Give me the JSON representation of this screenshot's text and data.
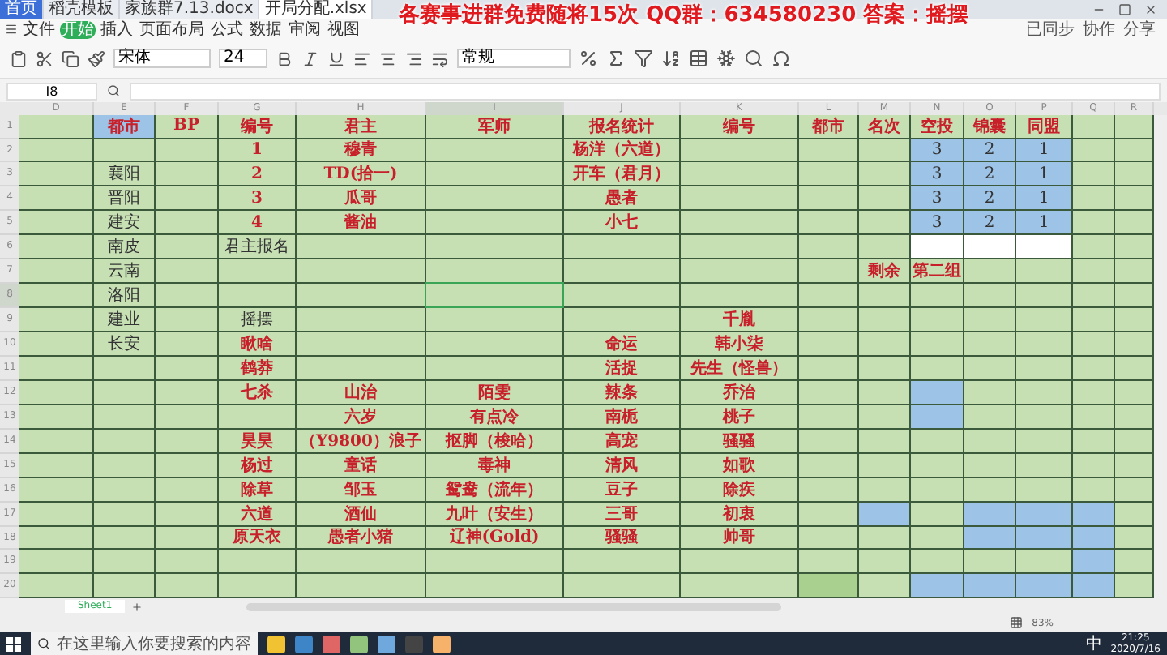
{
  "tabs": [
    {
      "label": "首页",
      "selected": false
    },
    {
      "label": "稻壳模板",
      "selected": false
    },
    {
      "label": "家族群7.13.docx",
      "selected": false
    },
    {
      "label": "开局分配.xlsx",
      "selected": true
    }
  ],
  "banner": "各赛事进群免费随将15次 QQ群：634580230 答案：摇摆",
  "menu": [
    {
      "label": "文件",
      "selected": false
    },
    {
      "label": "开始",
      "selected": true
    },
    {
      "label": "插入",
      "selected": false
    },
    {
      "label": "页面布局",
      "selected": false
    },
    {
      "label": "公式",
      "selected": false
    },
    {
      "label": "数据",
      "selected": false
    },
    {
      "label": "审阅",
      "selected": false
    },
    {
      "label": "视图",
      "selected": false
    }
  ],
  "sync": [
    "已同步",
    "协作",
    "分享"
  ],
  "toolbar": {
    "font": "宋体",
    "size": "24",
    "format": "常规"
  },
  "formula_bar": {
    "cell": "I8"
  },
  "columns": [
    {
      "letter": "D",
      "selected": false
    },
    {
      "letter": "E",
      "selected": false
    },
    {
      "letter": "F",
      "selected": false
    },
    {
      "letter": "G",
      "selected": false
    },
    {
      "letter": "H",
      "selected": false
    },
    {
      "letter": "I",
      "selected": true
    },
    {
      "letter": "J",
      "selected": false
    },
    {
      "letter": "K",
      "selected": false
    },
    {
      "letter": "L",
      "selected": false
    },
    {
      "letter": "M",
      "selected": false
    },
    {
      "letter": "N",
      "selected": false
    },
    {
      "letter": "O",
      "selected": false
    },
    {
      "letter": "P",
      "selected": false
    },
    {
      "letter": "Q",
      "selected": false
    },
    {
      "letter": "R",
      "selected": false
    }
  ],
  "rows": [
    {
      "number": "1",
      "selected": false,
      "cells": [
        {},
        {
          "text": "都市",
          "kind": "emphasis",
          "color": "#9dc3e6"
        },
        {
          "text": "BP",
          "kind": "emphasis"
        },
        {
          "text": "编号",
          "kind": "emphasis"
        },
        {
          "text": "君主",
          "kind": "emphasis"
        },
        {
          "text": "军师",
          "kind": "emphasis"
        },
        {
          "text": "报名统计",
          "kind": "emphasis"
        },
        {
          "text": "编号",
          "kind": "emphasis"
        },
        {
          "text": "都市",
          "kind": "emphasis"
        },
        {
          "text": "名次",
          "kind": "emphasis"
        },
        {
          "text": "空投",
          "kind": "emphasis"
        },
        {
          "text": "锦囊",
          "kind": "emphasis"
        },
        {
          "text": "同盟",
          "kind": "emphasis"
        },
        {},
        {}
      ]
    },
    {
      "number": "2",
      "selected": false,
      "cells": [
        {},
        {},
        {},
        {
          "text": "1",
          "kind": "emphasis"
        },
        {
          "text": "穆青",
          "kind": "emphasis"
        },
        {},
        {
          "text": "杨洋（六道）",
          "kind": "emphasis"
        },
        {},
        {},
        {},
        {
          "text": "3",
          "kind": "plain",
          "color": "#9dc3e6"
        },
        {
          "text": "2",
          "kind": "plain",
          "color": "#9dc3e6"
        },
        {
          "text": "1",
          "kind": "plain",
          "color": "#9dc3e6"
        },
        {},
        {}
      ]
    },
    {
      "number": "3",
      "selected": false,
      "cells": [
        {},
        {
          "text": "襄阳",
          "kind": "plain"
        },
        {},
        {
          "text": "2",
          "kind": "emphasis"
        },
        {
          "text": "TD(拾一)",
          "kind": "emphasis"
        },
        {},
        {
          "text": "开车（君月）",
          "kind": "emphasis"
        },
        {},
        {},
        {},
        {
          "text": "3",
          "kind": "plain",
          "color": "#9dc3e6"
        },
        {
          "text": "2",
          "kind": "plain",
          "color": "#9dc3e6"
        },
        {
          "text": "1",
          "kind": "plain",
          "color": "#9dc3e6"
        },
        {},
        {}
      ]
    },
    {
      "number": "4",
      "selected": false,
      "cells": [
        {},
        {
          "text": "晋阳",
          "kind": "plain"
        },
        {},
        {
          "text": "3",
          "kind": "emphasis"
        },
        {
          "text": "瓜哥",
          "kind": "emphasis"
        },
        {},
        {
          "text": "愚者",
          "kind": "emphasis"
        },
        {},
        {},
        {},
        {
          "text": "3",
          "kind": "plain",
          "color": "#9dc3e6"
        },
        {
          "text": "2",
          "kind": "plain",
          "color": "#9dc3e6"
        },
        {
          "text": "1",
          "kind": "plain",
          "color": "#9dc3e6"
        },
        {},
        {}
      ]
    },
    {
      "number": "5",
      "selected": false,
      "cells": [
        {},
        {
          "text": "建安",
          "kind": "plain"
        },
        {},
        {
          "text": "4",
          "kind": "emphasis"
        },
        {
          "text": "酱油",
          "kind": "emphasis"
        },
        {},
        {
          "text": "小七",
          "kind": "emphasis"
        },
        {},
        {},
        {},
        {
          "text": "3",
          "kind": "plain",
          "color": "#9dc3e6"
        },
        {
          "text": "2",
          "kind": "plain",
          "color": "#9dc3e6"
        },
        {
          "text": "1",
          "kind": "plain",
          "color": "#9dc3e6"
        },
        {},
        {}
      ]
    },
    {
      "number": "6",
      "selected": false,
      "cells": [
        {},
        {
          "text": "南皮",
          "kind": "plain"
        },
        {},
        {
          "text": "君主报名",
          "kind": "plain"
        },
        {},
        {},
        {},
        {},
        {},
        {},
        {
          "color": "#ffffff"
        },
        {
          "color": "#ffffff"
        },
        {
          "color": "#ffffff"
        },
        {},
        {}
      ]
    },
    {
      "number": "7",
      "selected": false,
      "cells": [
        {},
        {
          "text": "云南",
          "kind": "plain"
        },
        {},
        {},
        {},
        {},
        {},
        {},
        {},
        {
          "text": "剩余",
          "kind": "emphasis"
        },
        {
          "text": "第二组",
          "kind": "emphasis"
        },
        {},
        {},
        {},
        {}
      ]
    },
    {
      "number": "8",
      "selected": true,
      "cells": [
        {},
        {
          "text": "洛阳",
          "kind": "plain"
        },
        {},
        {},
        {},
        {},
        {},
        {},
        {},
        {},
        {},
        {},
        {},
        {},
        {}
      ]
    },
    {
      "number": "9",
      "selected": false,
      "cells": [
        {},
        {
          "text": "建业",
          "kind": "plain"
        },
        {},
        {
          "text": "摇摆",
          "kind": "plain"
        },
        {},
        {},
        {},
        {
          "text": "千胤",
          "kind": "emphasis"
        },
        {},
        {},
        {},
        {},
        {},
        {},
        {}
      ]
    },
    {
      "number": "10",
      "selected": false,
      "cells": [
        {},
        {
          "text": "长安",
          "kind": "plain"
        },
        {},
        {
          "text": "瞅啥",
          "kind": "emphasis"
        },
        {},
        {},
        {
          "text": "命运",
          "kind": "emphasis"
        },
        {
          "text": "韩小柒",
          "kind": "emphasis"
        },
        {},
        {},
        {},
        {},
        {},
        {},
        {}
      ]
    },
    {
      "number": "11",
      "selected": false,
      "cells": [
        {},
        {},
        {},
        {
          "text": "鹤莽",
          "kind": "emphasis"
        },
        {},
        {},
        {
          "text": "活捉",
          "kind": "emphasis"
        },
        {
          "text": "先生（怪兽）",
          "kind": "emphasis"
        },
        {},
        {},
        {},
        {},
        {},
        {},
        {}
      ]
    },
    {
      "number": "12",
      "selected": false,
      "cells": [
        {},
        {},
        {},
        {
          "text": "七杀",
          "kind": "emphasis"
        },
        {
          "text": "山治",
          "kind": "emphasis"
        },
        {
          "text": "陌雯",
          "kind": "emphasis"
        },
        {
          "text": "辣条",
          "kind": "emphasis"
        },
        {
          "text": "乔治",
          "kind": "emphasis"
        },
        {},
        {},
        {
          "color": "#9dc3e6"
        },
        {},
        {},
        {},
        {}
      ]
    },
    {
      "number": "13",
      "selected": false,
      "cells": [
        {},
        {},
        {},
        {},
        {
          "text": "六岁",
          "kind": "emphasis"
        },
        {
          "text": "有点冷",
          "kind": "emphasis"
        },
        {
          "text": "南栀",
          "kind": "emphasis"
        },
        {
          "text": "桃子",
          "kind": "emphasis"
        },
        {},
        {},
        {
          "color": "#9dc3e6"
        },
        {},
        {},
        {},
        {}
      ]
    },
    {
      "number": "14",
      "selected": false,
      "cells": [
        {},
        {},
        {},
        {
          "text": "昊昊",
          "kind": "emphasis"
        },
        {
          "text": "（Y9800）浪子",
          "kind": "emphasis"
        },
        {
          "text": "抠脚（梭哈）",
          "kind": "emphasis"
        },
        {
          "text": "高宠",
          "kind": "emphasis"
        },
        {
          "text": "骚骚",
          "kind": "emphasis"
        },
        {},
        {},
        {},
        {},
        {},
        {},
        {}
      ]
    },
    {
      "number": "15",
      "selected": false,
      "cells": [
        {},
        {},
        {},
        {
          "text": "杨过",
          "kind": "emphasis"
        },
        {
          "text": "童话",
          "kind": "emphasis"
        },
        {
          "text": "毒神",
          "kind": "emphasis"
        },
        {
          "text": "清风",
          "kind": "emphasis"
        },
        {
          "text": "如歌",
          "kind": "emphasis"
        },
        {},
        {},
        {},
        {},
        {},
        {},
        {}
      ]
    },
    {
      "number": "16",
      "selected": false,
      "cells": [
        {},
        {},
        {},
        {
          "text": "除草",
          "kind": "emphasis"
        },
        {
          "text": "邹玉",
          "kind": "emphasis"
        },
        {
          "text": "鸳鸯（流年）",
          "kind": "emphasis"
        },
        {
          "text": "豆子",
          "kind": "emphasis"
        },
        {
          "text": "除疾",
          "kind": "emphasis"
        },
        {},
        {},
        {},
        {},
        {},
        {},
        {}
      ]
    },
    {
      "number": "17",
      "selected": false,
      "cells": [
        {},
        {},
        {},
        {
          "text": "六道",
          "kind": "emphasis"
        },
        {
          "text": "酒仙",
          "kind": "emphasis"
        },
        {
          "text": "九叶（安生）",
          "kind": "emphasis"
        },
        {
          "text": "三哥",
          "kind": "emphasis"
        },
        {
          "text": "初衷",
          "kind": "emphasis"
        },
        {},
        {
          "color": "#9dc3e6"
        },
        {},
        {
          "color": "#9dc3e6"
        },
        {
          "color": "#9dc3e6"
        },
        {
          "color": "#9dc3e6"
        },
        {}
      ]
    },
    {
      "number": "18",
      "selected": false,
      "cells": [
        {},
        {},
        {},
        {
          "text": "原天衣",
          "kind": "emphasis"
        },
        {
          "text": "愚者小猪",
          "kind": "emphasis"
        },
        {
          "text": "辽神(Gold)",
          "kind": "emphasis"
        },
        {
          "text": "骚骚",
          "kind": "emphasis"
        },
        {
          "text": "帅哥",
          "kind": "emphasis"
        },
        {},
        {},
        {},
        {
          "color": "#9dc3e6"
        },
        {
          "color": "#9dc3e6"
        },
        {
          "color": "#9dc3e6"
        },
        {}
      ]
    },
    {
      "number": "19",
      "selected": false,
      "cells": [
        {},
        {},
        {},
        {},
        {},
        {},
        {},
        {},
        {},
        {},
        {},
        {},
        {},
        {
          "color": "#9dc3e6"
        },
        {}
      ]
    },
    {
      "number": "20",
      "selected": false,
      "cells": [
        {},
        {},
        {},
        {},
        {},
        {},
        {},
        {},
        {
          "color": "#a9d08e"
        },
        {},
        {
          "color": "#9dc3e6"
        },
        {
          "color": "#9dc3e6"
        },
        {
          "color": "#9dc3e6"
        },
        {
          "color": "#9dc3e6"
        },
        {}
      ]
    }
  ],
  "sheets": [
    {
      "label": "Sheet1",
      "selected": true
    }
  ],
  "status": {
    "zoom": "83%"
  },
  "taskbar": {
    "search_placeholder": "在这里输入你要搜索的内容",
    "ime": "中",
    "time": "21:25",
    "date": "2020/7/16"
  }
}
